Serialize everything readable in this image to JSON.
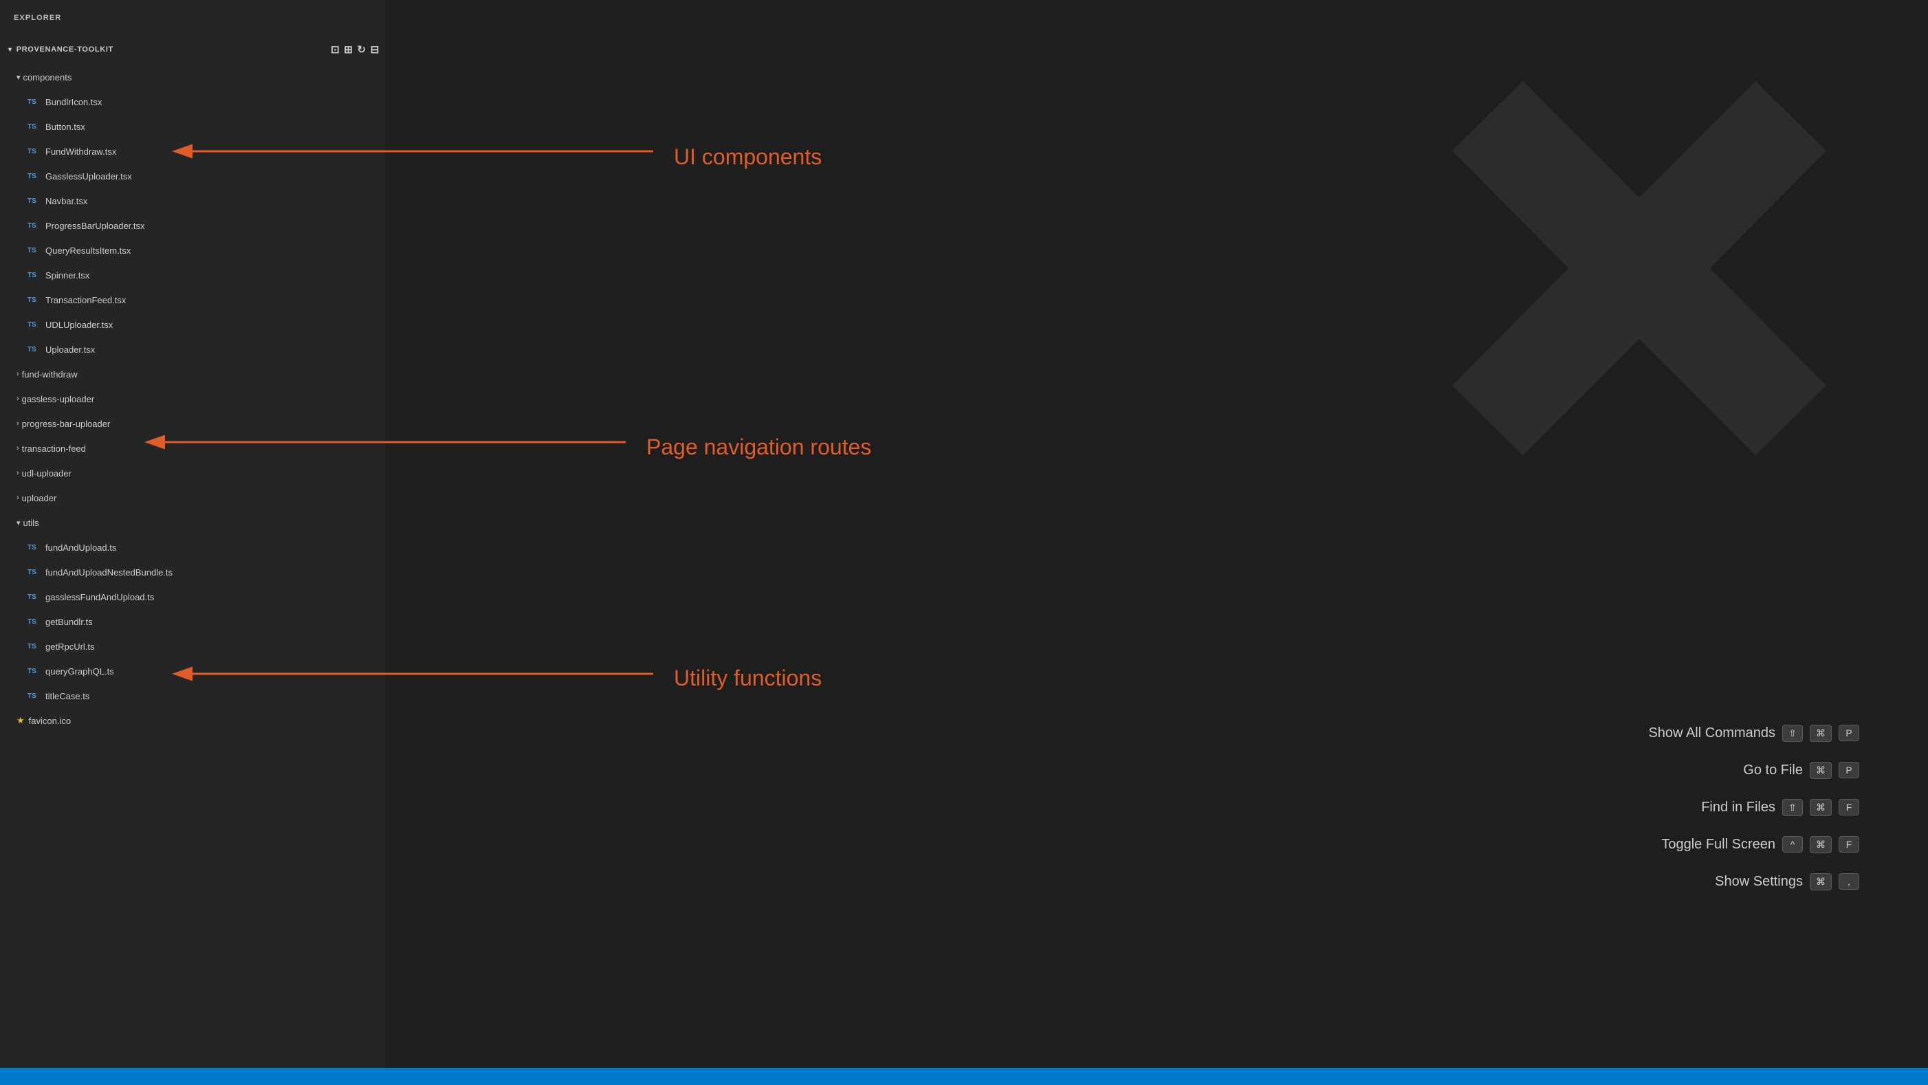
{
  "explorer": {
    "title": "EXPLORER",
    "more_icon": "···",
    "project": {
      "name": "PROVENANCE-TOOLKIT",
      "icons": [
        "new-file",
        "new-folder",
        "refresh",
        "collapse"
      ]
    },
    "tree": [
      {
        "type": "folder",
        "name": "components",
        "indent": 1,
        "open": true
      },
      {
        "type": "file",
        "name": "BundlrIcon.tsx",
        "badge": "TS",
        "indent": 2
      },
      {
        "type": "file",
        "name": "Button.tsx",
        "badge": "TS",
        "indent": 2
      },
      {
        "type": "file",
        "name": "FundWithdraw.tsx",
        "badge": "TS",
        "indent": 2
      },
      {
        "type": "file",
        "name": "GasslessUploader.tsx",
        "badge": "TS",
        "indent": 2
      },
      {
        "type": "file",
        "name": "Navbar.tsx",
        "badge": "TS",
        "indent": 2
      },
      {
        "type": "file",
        "name": "ProgressBarUploader.tsx",
        "badge": "TS",
        "indent": 2
      },
      {
        "type": "file",
        "name": "QueryResultsItem.tsx",
        "badge": "TS",
        "indent": 2
      },
      {
        "type": "file",
        "name": "Spinner.tsx",
        "badge": "TS",
        "indent": 2
      },
      {
        "type": "file",
        "name": "TransactionFeed.tsx",
        "badge": "TS",
        "indent": 2
      },
      {
        "type": "file",
        "name": "UDLUploader.tsx",
        "badge": "TS",
        "indent": 2
      },
      {
        "type": "file",
        "name": "Uploader.tsx",
        "badge": "TS",
        "indent": 2
      },
      {
        "type": "folder",
        "name": "fund-withdraw",
        "indent": 1,
        "open": false
      },
      {
        "type": "folder",
        "name": "gassless-uploader",
        "indent": 1,
        "open": false
      },
      {
        "type": "folder",
        "name": "progress-bar-uploader",
        "indent": 1,
        "open": false
      },
      {
        "type": "folder",
        "name": "transaction-feed",
        "indent": 1,
        "open": false
      },
      {
        "type": "folder",
        "name": "udl-uploader",
        "indent": 1,
        "open": false
      },
      {
        "type": "folder",
        "name": "uploader",
        "indent": 1,
        "open": false
      },
      {
        "type": "folder",
        "name": "utils",
        "indent": 1,
        "open": true
      },
      {
        "type": "file",
        "name": "fundAndUpload.ts",
        "badge": "TS",
        "indent": 2
      },
      {
        "type": "file",
        "name": "fundAndUploadNestedBundle.ts",
        "badge": "TS",
        "indent": 2
      },
      {
        "type": "file",
        "name": "gasslessFundAndUpload.ts",
        "badge": "TS",
        "indent": 2
      },
      {
        "type": "file",
        "name": "getBundlr.ts",
        "badge": "TS",
        "indent": 2
      },
      {
        "type": "file",
        "name": "getRpcUrl.ts",
        "badge": "TS",
        "indent": 2
      },
      {
        "type": "file",
        "name": "queryGraphQL.ts",
        "badge": "TS",
        "indent": 2
      },
      {
        "type": "file",
        "name": "titleCase.ts",
        "badge": "TS",
        "indent": 2
      },
      {
        "type": "file",
        "name": "favicon.ico",
        "badge": "★",
        "indent": 1
      }
    ]
  },
  "annotations": {
    "ui_components": "UI components",
    "page_navigation": "Page navigation routes",
    "utility_functions": "Utility functions"
  },
  "command_palette": {
    "items": [
      {
        "label": "Show All Commands",
        "keys": [
          "⇧",
          "⌘",
          "P"
        ]
      },
      {
        "label": "Go to File",
        "keys": [
          "⌘",
          "P"
        ]
      },
      {
        "label": "Find in Files",
        "keys": [
          "⇧",
          "⌘",
          "F"
        ]
      },
      {
        "label": "Toggle Full Screen",
        "keys": [
          "^",
          "⌘",
          "F"
        ]
      },
      {
        "label": "Show Settings",
        "keys": [
          "⌘",
          ","
        ]
      }
    ]
  },
  "colors": {
    "accent_blue": "#007acc",
    "arrow_orange": "#e05d2a",
    "ts_blue": "#569cd6",
    "folder_color": "#cccccc"
  }
}
